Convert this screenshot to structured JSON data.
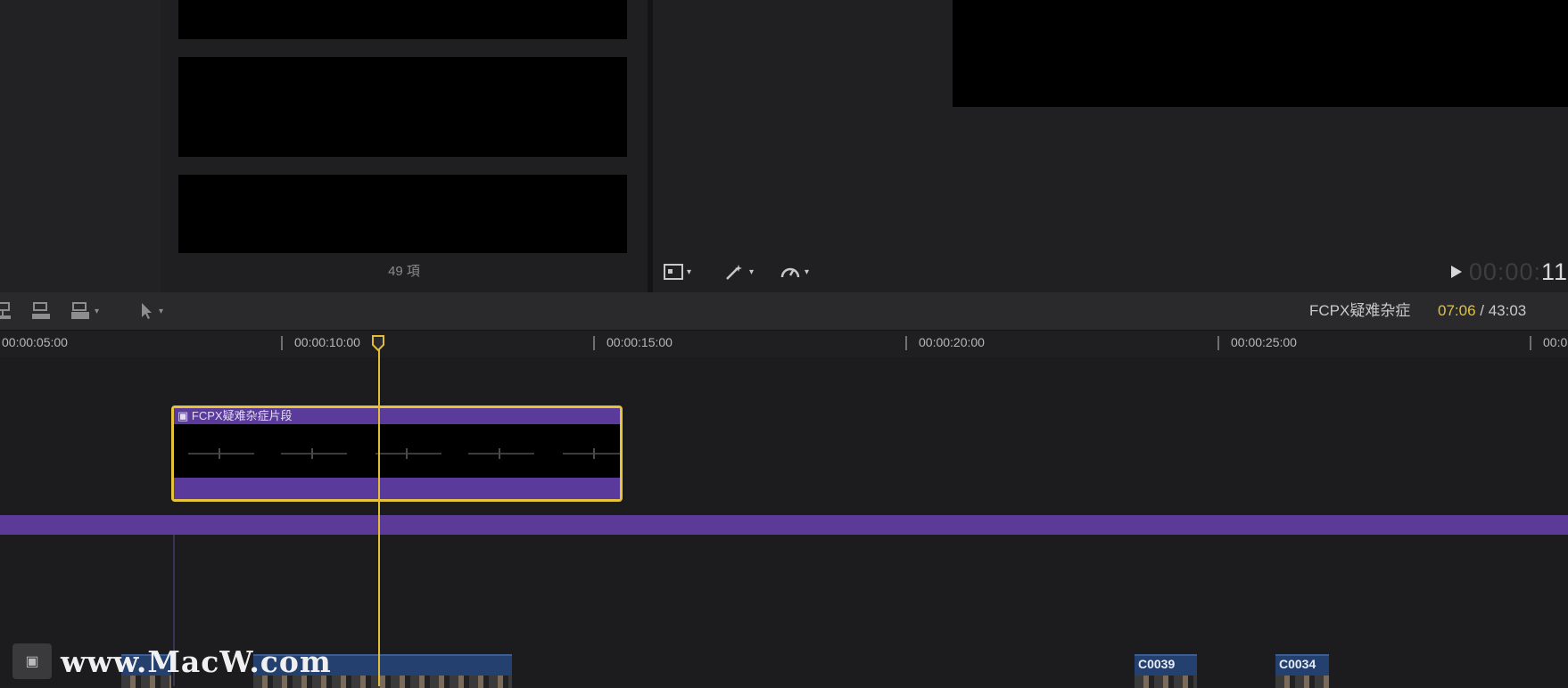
{
  "browser": {
    "item_count": "49 項"
  },
  "viewer": {
    "timecode_dim": "00:00:",
    "timecode_bright": "11",
    "play_icon": "play-icon",
    "tools": [
      "viewer-view-options-icon",
      "enhance-icon",
      "retime-icon"
    ]
  },
  "timeline_toolbar": {
    "project_name": "FCPX疑难杂症",
    "current": "07:06",
    "separator": " / ",
    "total": "43:03",
    "tools": [
      "connect-clip-icon",
      "insert-clip-icon",
      "overwrite-clip-icon",
      "select-tool-icon"
    ]
  },
  "ruler": {
    "labels": [
      "00:00:05:00",
      "00:00:10:00",
      "00:00:15:00",
      "00:00:20:00",
      "00:00:25:00",
      "00:0"
    ]
  },
  "timeline": {
    "compound_clip_title": "FCPX疑难杂症片段",
    "video_clips": [
      "",
      "",
      "C0039",
      "C0034"
    ]
  },
  "watermark": {
    "text": "www.MacW.com"
  },
  "colors": {
    "accent": "#e2be38",
    "storyline": "#5b3a98",
    "clip_blue": "#24406e"
  }
}
